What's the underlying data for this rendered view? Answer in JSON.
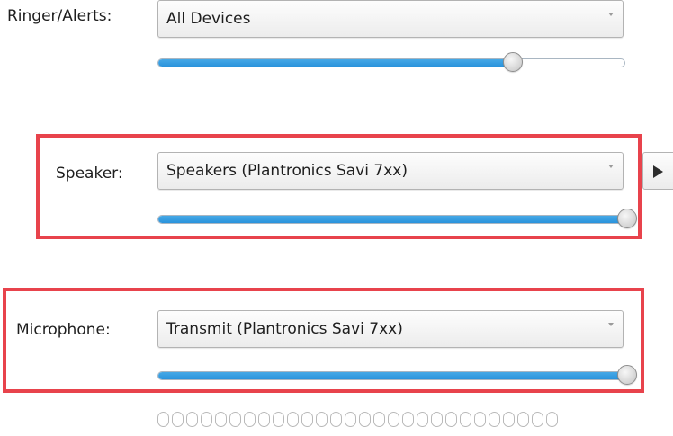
{
  "ringer": {
    "label": "Ringer/Alerts:",
    "device": "All Devices",
    "level": 0.76
  },
  "speaker": {
    "label": "Speaker:",
    "device": "Speakers (Plantronics Savi 7xx)",
    "level": 1.0
  },
  "microphone": {
    "label": "Microphone:",
    "device": "Transmit (Plantronics Savi 7xx)",
    "level": 1.0,
    "input_meter_segments_lit": 0,
    "input_meter_segments_total": 28
  },
  "colors": {
    "slider_fill": "#2a93dc",
    "highlight_border": "#e8434c"
  },
  "icons": {
    "dropdown_arrow": "chevron-down-icon",
    "test_sound": "play-icon",
    "thumb": "slider-thumb"
  }
}
